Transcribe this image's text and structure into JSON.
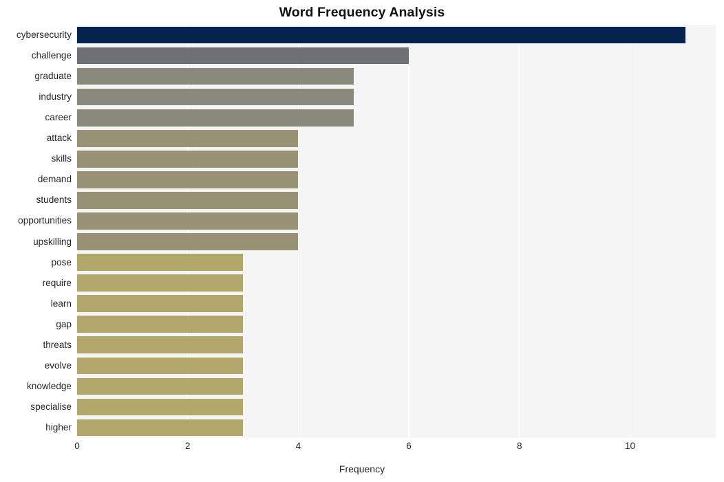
{
  "chart_data": {
    "type": "bar",
    "orientation": "horizontal",
    "title": "Word Frequency Analysis",
    "xlabel": "Frequency",
    "ylabel": "",
    "xlim": [
      0,
      11.55
    ],
    "xticks": [
      0,
      2,
      4,
      6,
      8,
      10
    ],
    "xtick_labels": [
      "0",
      "2",
      "4",
      "6",
      "8",
      "10"
    ],
    "grid": true,
    "grid_axis": "x",
    "grid_color": "#ffffff",
    "plot_background": "#f5f5f6",
    "figure_background": "#ffffff",
    "legend": null,
    "categories": [
      "cybersecurity",
      "challenge",
      "graduate",
      "industry",
      "career",
      "attack",
      "skills",
      "demand",
      "students",
      "opportunities",
      "upskilling",
      "pose",
      "require",
      "learn",
      "gap",
      "threats",
      "evolve",
      "knowledge",
      "specialise",
      "higher"
    ],
    "values": [
      11,
      6,
      5,
      5,
      5,
      4,
      4,
      4,
      4,
      4,
      4,
      3,
      3,
      3,
      3,
      3,
      3,
      3,
      3,
      3
    ],
    "bar_colors": [
      "#06234f",
      "#6e7075",
      "#8a8a7c",
      "#8a8a7c",
      "#8a8a7c",
      "#9a9276",
      "#9a9276",
      "#9a9276",
      "#9a9276",
      "#9a9276",
      "#9a9276",
      "#b2a76b",
      "#b2a76b",
      "#b2a76b",
      "#b2a76b",
      "#b2a76b",
      "#b2a76b",
      "#b2a76b",
      "#b2a76b",
      "#b2a76b"
    ]
  }
}
